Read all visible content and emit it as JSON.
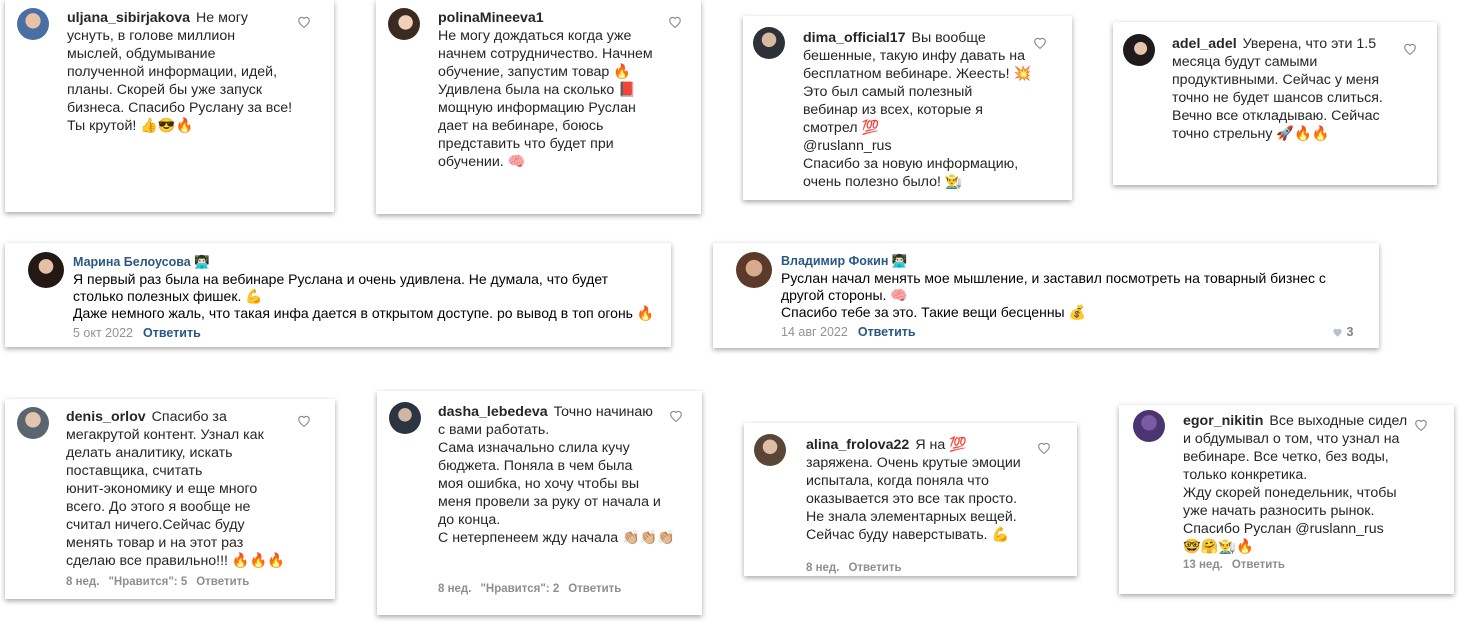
{
  "comments": [
    {
      "user": "uljana_sibirjakova",
      "text": "Не могу\nуснуть, в голове миллион\nмыслей, обдумывание\nполученной информации, идей,\nпланы. Скорей бы уже запуск\nбизнеса. Спасибо Руслану за все!\nТы крутой!",
      "emoji": "👍😎🔥"
    },
    {
      "user": "polinaMineeva1",
      "text": "Не могу дождаться когда уже\nначнем сотрудничество. Начнем\nобучение, запустим товар 🔥\nУдивлена была на сколько 📕\nмощную информацию Руслан\nдает на вебинаре, боюсь\nпредставить что будет при\nобучении. 🧠"
    },
    {
      "user": "dima_official17",
      "text": "Вы вообще\nбешенные, такую инфу давать на\nбесплатном вебинаре. Жеесть! 💥\nЭто был самый полезный\nвебинар из всех, которые я\nсмотрел 💯\n@ruslann_rus\nСпасибо за новую информацию,\nочень полезно было! 👨‍🌾"
    },
    {
      "user": "adel_adel",
      "text": "Уверена, что эти 1.5\nмесяца будут самыми\nпродуктивными. Сейчас у меня\nточно не будет шансов слиться.\nВечно все откладываю. Сейчас\nточно стрельну 🚀🔥🔥"
    },
    {
      "user": "denis_orlov",
      "text": "Спасибо за\nмегакрутой контент. Узнал как\nделать аналитику, искать\nпоставщика, считать\nюнит-экономику и еще много\nвсего. До этого я вообще не\nсчитал ничего.Сейчас буду\nменять товар и на этот раз\nсделаю все правильно!!! 🔥🔥🔥",
      "time": "8 нед.",
      "likes": "\"Нравится\": 5",
      "reply": "Ответить"
    },
    {
      "user": "dasha_lebedeva",
      "text": "Точно начинаю\nс вами работать.\nСама изначально слила кучу\nбюджета. Поняла в чем была\nмоя ошибка, но хочу чтобы вы\nменя провели за руку от начала и\nдо конца.\nС нетерпенеем жду начала 👏🏼👏🏼👏🏼",
      "time": "8 нед.",
      "likes": "\"Нравится\": 2",
      "reply": "Ответить"
    },
    {
      "user": "alina_frolova22",
      "text": "Я на 💯\nзаряжена. Очень крутые эмоции\nиспытала, когда поняла что\nоказывается это все так просто.\nНе знала элементарных вещей.\nСейчас буду наверстывать. 💪",
      "time": "8 нед.",
      "reply": "Ответить"
    },
    {
      "user": "egor_nikitin",
      "text": "Все выходные сидел\nи обдумывал о том, что узнал на\nвебинаре. Все четко, без воды,\nтолько конкретика.\nЖду скорей понедельник, чтобы\nуже начать разносить рынок.\nСпасибо Руслан @ruslann_rus\n🤓🤗👨‍🌾🔥",
      "time": "13 нед.",
      "reply": "Ответить"
    }
  ],
  "vk": [
    {
      "name": "Марина Белоусова 👨🏻‍💻",
      "text": "Я первый раз была на вебинаре Руслана и очень удивлена. Не думала, что будет\nстолько полезных фишек. 💪\nДаже немного жаль, что такая инфа дается в открытом доступе. ро вывод в топ огонь    🔥",
      "date": "5 окт 2022",
      "reply": "Ответить"
    },
    {
      "name": "Владимир Фокин 👨🏻‍💻",
      "text": "Руслан начал менять мое мышление, и заставил посмотреть на товарный бизнес с\nдругой стороны. 🧠\nСпасибо тебе за это. Такие вещи бесценны 💰",
      "date": "14 авг 2022",
      "reply": "Ответить",
      "likes": "3"
    }
  ],
  "colors": {
    "vk_link": "#2a5885",
    "meta_gray": "#8e8e8e"
  }
}
